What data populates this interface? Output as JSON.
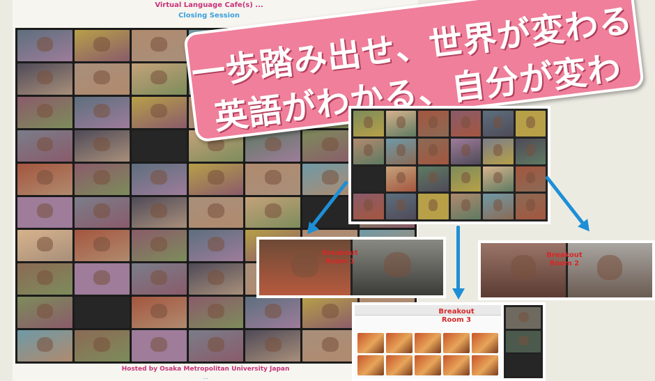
{
  "poster": {
    "top_title": "Virtual Language Cafe(s) ...",
    "top_subtitle": "Closing Session",
    "bottom_credit": "Hosted by Osaka Metropolitan University Japan",
    "bottom_credit2": "...",
    "banner_line1": "一歩踏み出せ、世界が変わる",
    "banner_line2": "英語がわかる、自分が変わる!"
  },
  "breakout_rooms": [
    {
      "label": "Breakout Room 1"
    },
    {
      "label": "Breakout Room 2"
    },
    {
      "label": "Breakout Room 3"
    }
  ],
  "colors": {
    "banner": "#ef7f9a",
    "arrow": "#1d8fd6",
    "label_red": "#d62828",
    "title_pink": "#c7317a",
    "title_blue": "#3aa0de"
  }
}
